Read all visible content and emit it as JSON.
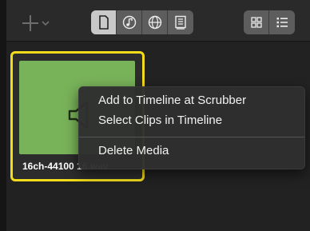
{
  "toolbar": {
    "add_icon": "plus-icon",
    "media_tabs": [
      {
        "icon": "document-icon",
        "selected": true
      },
      {
        "icon": "music-icon",
        "selected": false
      },
      {
        "icon": "globe-icon",
        "selected": false
      },
      {
        "icon": "book-icon",
        "selected": false
      }
    ],
    "view_modes": [
      {
        "icon": "grid-view-icon",
        "selected": false
      },
      {
        "icon": "list-view-icon",
        "selected": false
      }
    ]
  },
  "clip": {
    "name": "16ch-44100 16.wav",
    "thumbnail_icon": "speaker-icon",
    "highlight_color": "#f2dc1c",
    "thumbnail_color": "#78b259"
  },
  "context_menu": {
    "items": [
      "Add to Timeline at Scrubber",
      "Select Clips in Timeline",
      "Delete Media"
    ]
  }
}
